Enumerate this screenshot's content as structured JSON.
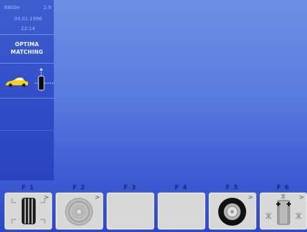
{
  "status": {
    "code": "6800e",
    "version": "2.9",
    "date": "04.01.1996",
    "time": "22:14"
  },
  "mode": {
    "line1": "OPTIMA",
    "line2": "MATCHING"
  },
  "function_keys": [
    {
      "label": "F 1",
      "icon": "tire-tread-icon",
      "has_submenu": true
    },
    {
      "label": "F 2",
      "icon": "rim-icon",
      "has_submenu": true
    },
    {
      "label": "F 3",
      "icon": "",
      "has_submenu": false
    },
    {
      "label": "F 4",
      "icon": "",
      "has_submenu": false
    },
    {
      "label": "F 5",
      "icon": "tire-icon",
      "has_submenu": true
    },
    {
      "label": "F 6",
      "icon": "balance-weights-icon",
      "has_submenu": true
    }
  ],
  "submenu_glyph": ">",
  "colors": {
    "background_top": "#6d8fe3",
    "background_bottom": "#2b46c8",
    "sidebar": "#3452c9",
    "car": "#f2d21b",
    "key_face": "#d8d8d8"
  }
}
